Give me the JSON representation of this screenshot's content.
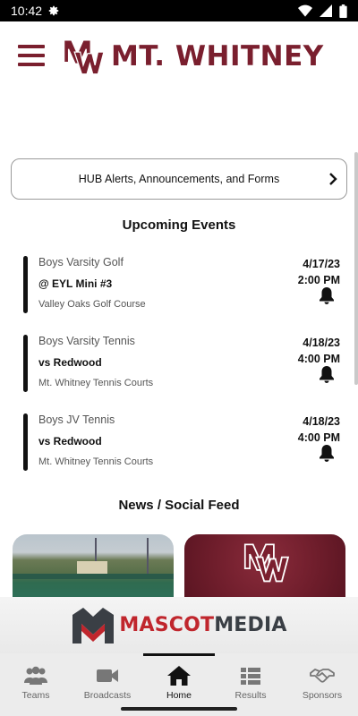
{
  "status_bar": {
    "time": "10:42",
    "icons": [
      "settings-gear-icon",
      "wifi-icon",
      "signal-icon",
      "battery-icon"
    ]
  },
  "header": {
    "brand_name": "MT. WHITNEY",
    "logo_letters": "MW",
    "brand_color": "#7a1f2e"
  },
  "alerts": {
    "label": "HUB Alerts, Announcements, and Forms"
  },
  "upcoming": {
    "title": "Upcoming Events",
    "events": [
      {
        "team": "Boys Varsity Golf",
        "opponent": "@ EYL Mini #3",
        "location": "Valley Oaks Golf Course",
        "date": "4/17/23",
        "time": "2:00 PM"
      },
      {
        "team": "Boys Varsity Tennis",
        "opponent": "vs Redwood",
        "location": "Mt. Whitney Tennis Courts",
        "date": "4/18/23",
        "time": "4:00 PM"
      },
      {
        "team": "Boys JV Tennis",
        "opponent": "vs Redwood",
        "location": "Mt. Whitney Tennis Courts",
        "date": "4/18/23",
        "time": "4:00 PM"
      }
    ]
  },
  "news": {
    "title": "News / Social Feed"
  },
  "sponsor": {
    "mascot": "MASCOT",
    "media": "MEDIA"
  },
  "nav": {
    "items": [
      {
        "label": "Teams",
        "icon": "teams-icon"
      },
      {
        "label": "Broadcasts",
        "icon": "video-camera-icon"
      },
      {
        "label": "Home",
        "icon": "home-icon",
        "active": true
      },
      {
        "label": "Results",
        "icon": "results-list-icon"
      },
      {
        "label": "Sponsors",
        "icon": "handshake-icon"
      }
    ]
  }
}
